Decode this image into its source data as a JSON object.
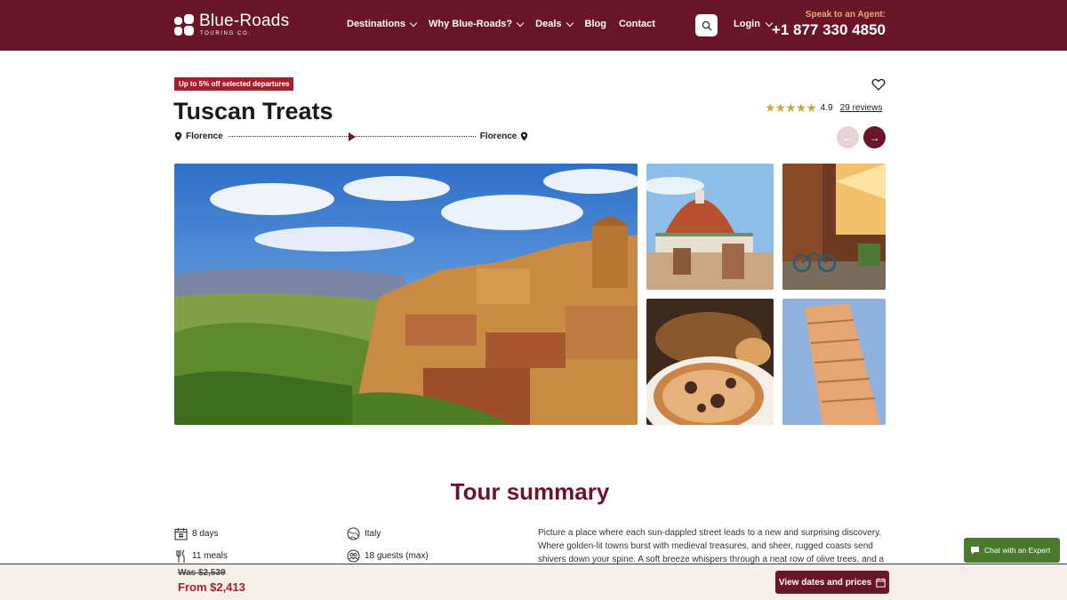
{
  "header": {
    "logo_name": "Blue-Roads",
    "logo_sub": "TOURING CO.",
    "nav": [
      {
        "label": "Destinations",
        "has_dropdown": true
      },
      {
        "label": "Why Blue-Roads?",
        "has_dropdown": true
      },
      {
        "label": "Deals",
        "has_dropdown": true
      },
      {
        "label": "Blog",
        "has_dropdown": false
      },
      {
        "label": "Contact",
        "has_dropdown": false
      }
    ],
    "search_icon": "search-icon",
    "login_label": "Login",
    "agent_label": "Speak to an Agent:",
    "agent_phone": "+1 877 330 4850"
  },
  "tour": {
    "promo_badge": "Up to 5% off selected departures",
    "title": "Tuscan Treats",
    "rating_value": "4.9",
    "rating_stars": 5,
    "reviews_link": "29 reviews",
    "route_start": "Florence",
    "route_end": "Florence"
  },
  "gallery": {
    "images": [
      "tuscan-hill-town",
      "florence-duomo",
      "street-with-bicycles",
      "italian-pastries",
      "leaning-tower-of-pisa"
    ]
  },
  "summary": {
    "heading": "Tour summary",
    "facts": [
      {
        "icon": "calendar-icon",
        "label": "8 days"
      },
      {
        "icon": "globe-icon",
        "label": "Italy"
      },
      {
        "icon": "utensils-icon",
        "label": "11 meals"
      },
      {
        "icon": "guests-icon",
        "label": "18 guests (max)"
      }
    ],
    "description": "Picture a place where each sun-dappled street leads to a new and surprising discovery. Where golden-lit towns burst with medieval treasures, and sheer, rugged coasts send shivers down your spine. A soft breeze whispers through a neat row of olive trees, and a"
  },
  "pricing": {
    "was_label": "Was $2,539",
    "from_label": "From $2,413",
    "cta_label": "View dates and prices"
  },
  "chat": {
    "label": "Chat with an Expert"
  },
  "colors": {
    "brand": "#6b1528",
    "promo": "#a51f2e",
    "agent_accent": "#e9a979",
    "chat": "#4a7a2e",
    "stars": "#c9a93c"
  }
}
